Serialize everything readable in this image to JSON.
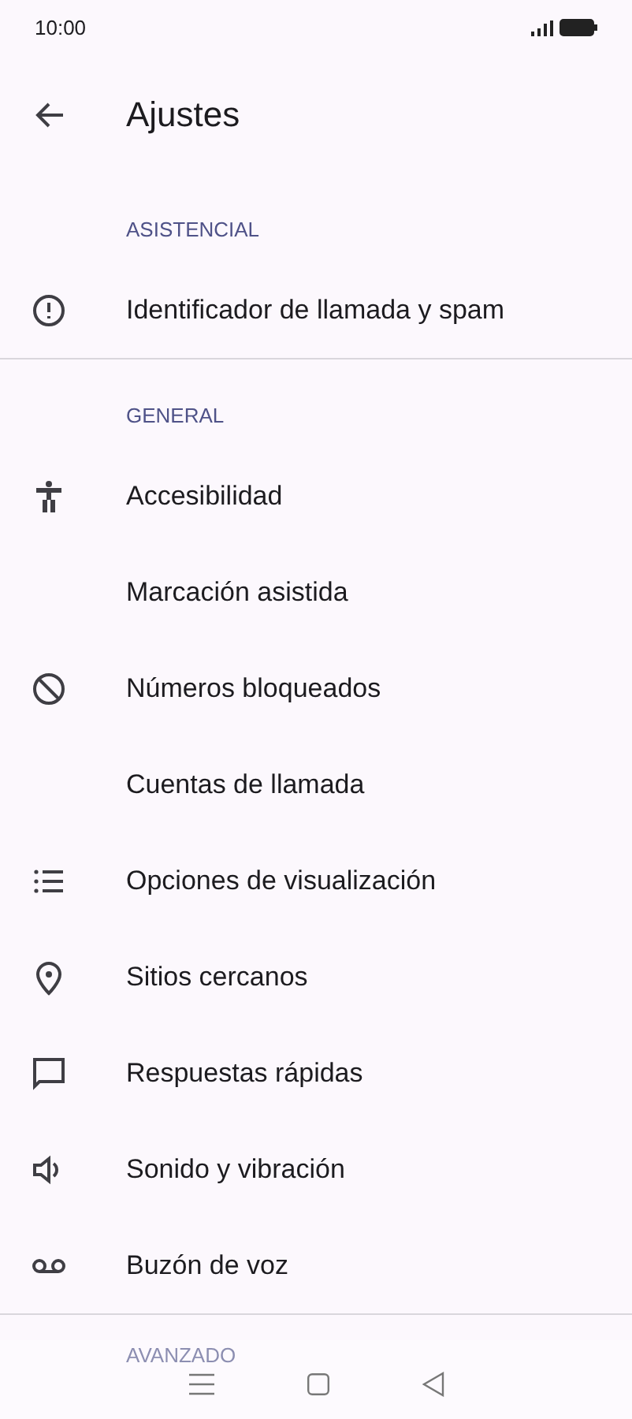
{
  "status_bar": {
    "time": "10:00"
  },
  "app_bar": {
    "title": "Ajustes"
  },
  "sections": [
    {
      "title": "ASISTENCIAL",
      "items": [
        {
          "label": "Identificador de llamada y spam"
        }
      ]
    },
    {
      "title": "GENERAL",
      "items": [
        {
          "label": "Accesibilidad"
        },
        {
          "label": "Marcación asistida"
        },
        {
          "label": "Números bloqueados"
        },
        {
          "label": "Cuentas de llamada"
        },
        {
          "label": "Opciones de visualización"
        },
        {
          "label": "Sitios cercanos"
        },
        {
          "label": "Respuestas rápidas"
        },
        {
          "label": "Sonido y vibración"
        },
        {
          "label": "Buzón de voz"
        }
      ]
    },
    {
      "title": "AVANZADO"
    }
  ]
}
